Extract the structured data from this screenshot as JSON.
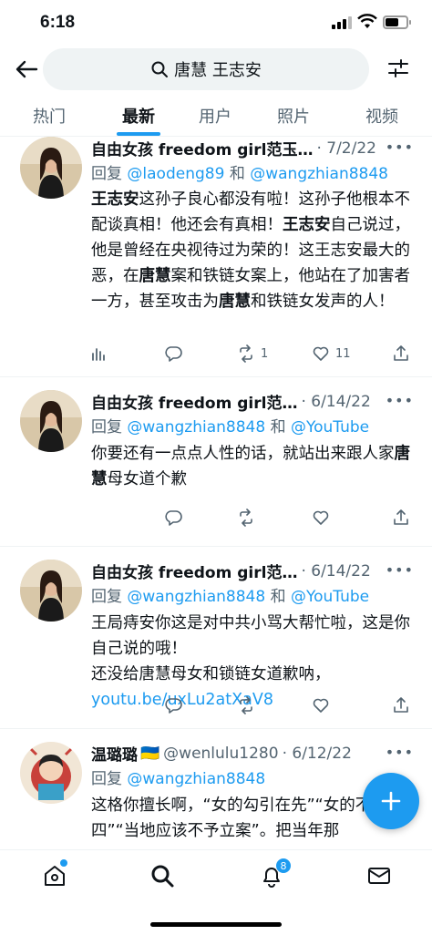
{
  "status_bar": {
    "time": "6:18"
  },
  "search": {
    "query": "唐慧 王志安"
  },
  "tabs": [
    {
      "label": "热门",
      "active": false
    },
    {
      "label": "最新",
      "active": true
    },
    {
      "label": "用户",
      "active": false
    },
    {
      "label": "照片",
      "active": false
    },
    {
      "label": "视频",
      "active": false
    }
  ],
  "tweets": [
    {
      "name": "自由女孩 freedom girl范玉…",
      "date": "· 7/2/22",
      "reply_prefix": "回复",
      "reply_user1": "@laodeng89",
      "reply_and": "和",
      "reply_user2": "@wangzhian8848",
      "text": [
        "王志安",
        "这孙子良心都没有啦！这孙子他根本不配谈真相！他还会有真相！",
        "王志安",
        "自己说过，他是曾经在央视待过为荣的！这王志安最大的恶，在",
        "唐慧",
        "案和铁链女案上，他站在了加害者一方，甚至攻击为",
        "唐慧",
        "和铁链女发声的人！"
      ],
      "retweets": "1",
      "likes": "11"
    },
    {
      "name": "自由女孩 freedom girl范…",
      "date": "· 6/14/22",
      "reply_prefix": "回复",
      "reply_user1": "@wangzhian8848",
      "reply_and": "和",
      "reply_user2": "@YouTube",
      "text": [
        "你要还有一点点人性的话，就站出来跟人家",
        "唐慧",
        "母女道个歉"
      ]
    },
    {
      "name": "自由女孩 freedom girl范…",
      "date": "· 6/14/22",
      "reply_prefix": "回复",
      "reply_user1": "@wangzhian8848",
      "reply_and": "和",
      "reply_user2": "@YouTube",
      "text_line1": "王局痔安你这是对中共小骂大帮忙啦，这是你自己说的哦！",
      "text_line2": "还没给唐慧母女和锁链女道歉呐，",
      "link": "youtu.be/uxLu2atXaV8"
    },
    {
      "name": "温璐璐",
      "flag": "🇺🇦",
      "handle": "@wenlulu1280",
      "date": "· 6/12/22",
      "reply_prefix": "回复",
      "reply_user1": "@wangzhian8848",
      "text": "这格你擅长啊，“女的勾引在先”“女的不三不四”“当地应该不予立案”。把当年那"
    }
  ],
  "bottom_nav": {
    "notifications_count": "8"
  },
  "colors": {
    "accent": "#1d9bf0",
    "muted": "#536471",
    "text": "#0f1419"
  },
  "icons": [
    "back-arrow-icon",
    "search-icon",
    "filter-icon",
    "reply-icon",
    "retweet-icon",
    "like-icon",
    "share-icon",
    "views-icon",
    "home-icon",
    "notifications-icon",
    "messages-icon",
    "compose-icon"
  ]
}
